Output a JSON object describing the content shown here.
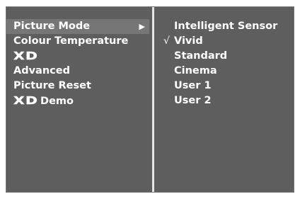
{
  "menu": {
    "items": [
      {
        "label": "Picture Mode",
        "type": "text",
        "selected": true,
        "has_submenu": true,
        "arrow": "▶"
      },
      {
        "label": "Colour Temperature",
        "type": "text"
      },
      {
        "label": "XD",
        "type": "logo"
      },
      {
        "label": "Advanced",
        "type": "text"
      },
      {
        "label": "Picture Reset",
        "type": "text"
      },
      {
        "logo": "XD",
        "label": "Demo",
        "type": "logo-text"
      }
    ]
  },
  "submenu": {
    "check_mark": "√",
    "options": [
      {
        "label": "Intelligent Sensor",
        "checked": false
      },
      {
        "label": "Vivid",
        "checked": true
      },
      {
        "label": "Standard",
        "checked": false
      },
      {
        "label": "Cinema",
        "checked": false
      },
      {
        "label": "User 1",
        "checked": false
      },
      {
        "label": "User 2",
        "checked": false
      }
    ]
  },
  "colors": {
    "panel_background": "#5e5e5e",
    "selected_background": "#767676",
    "divider": "#e6e6e6",
    "text": "#ffffff"
  }
}
